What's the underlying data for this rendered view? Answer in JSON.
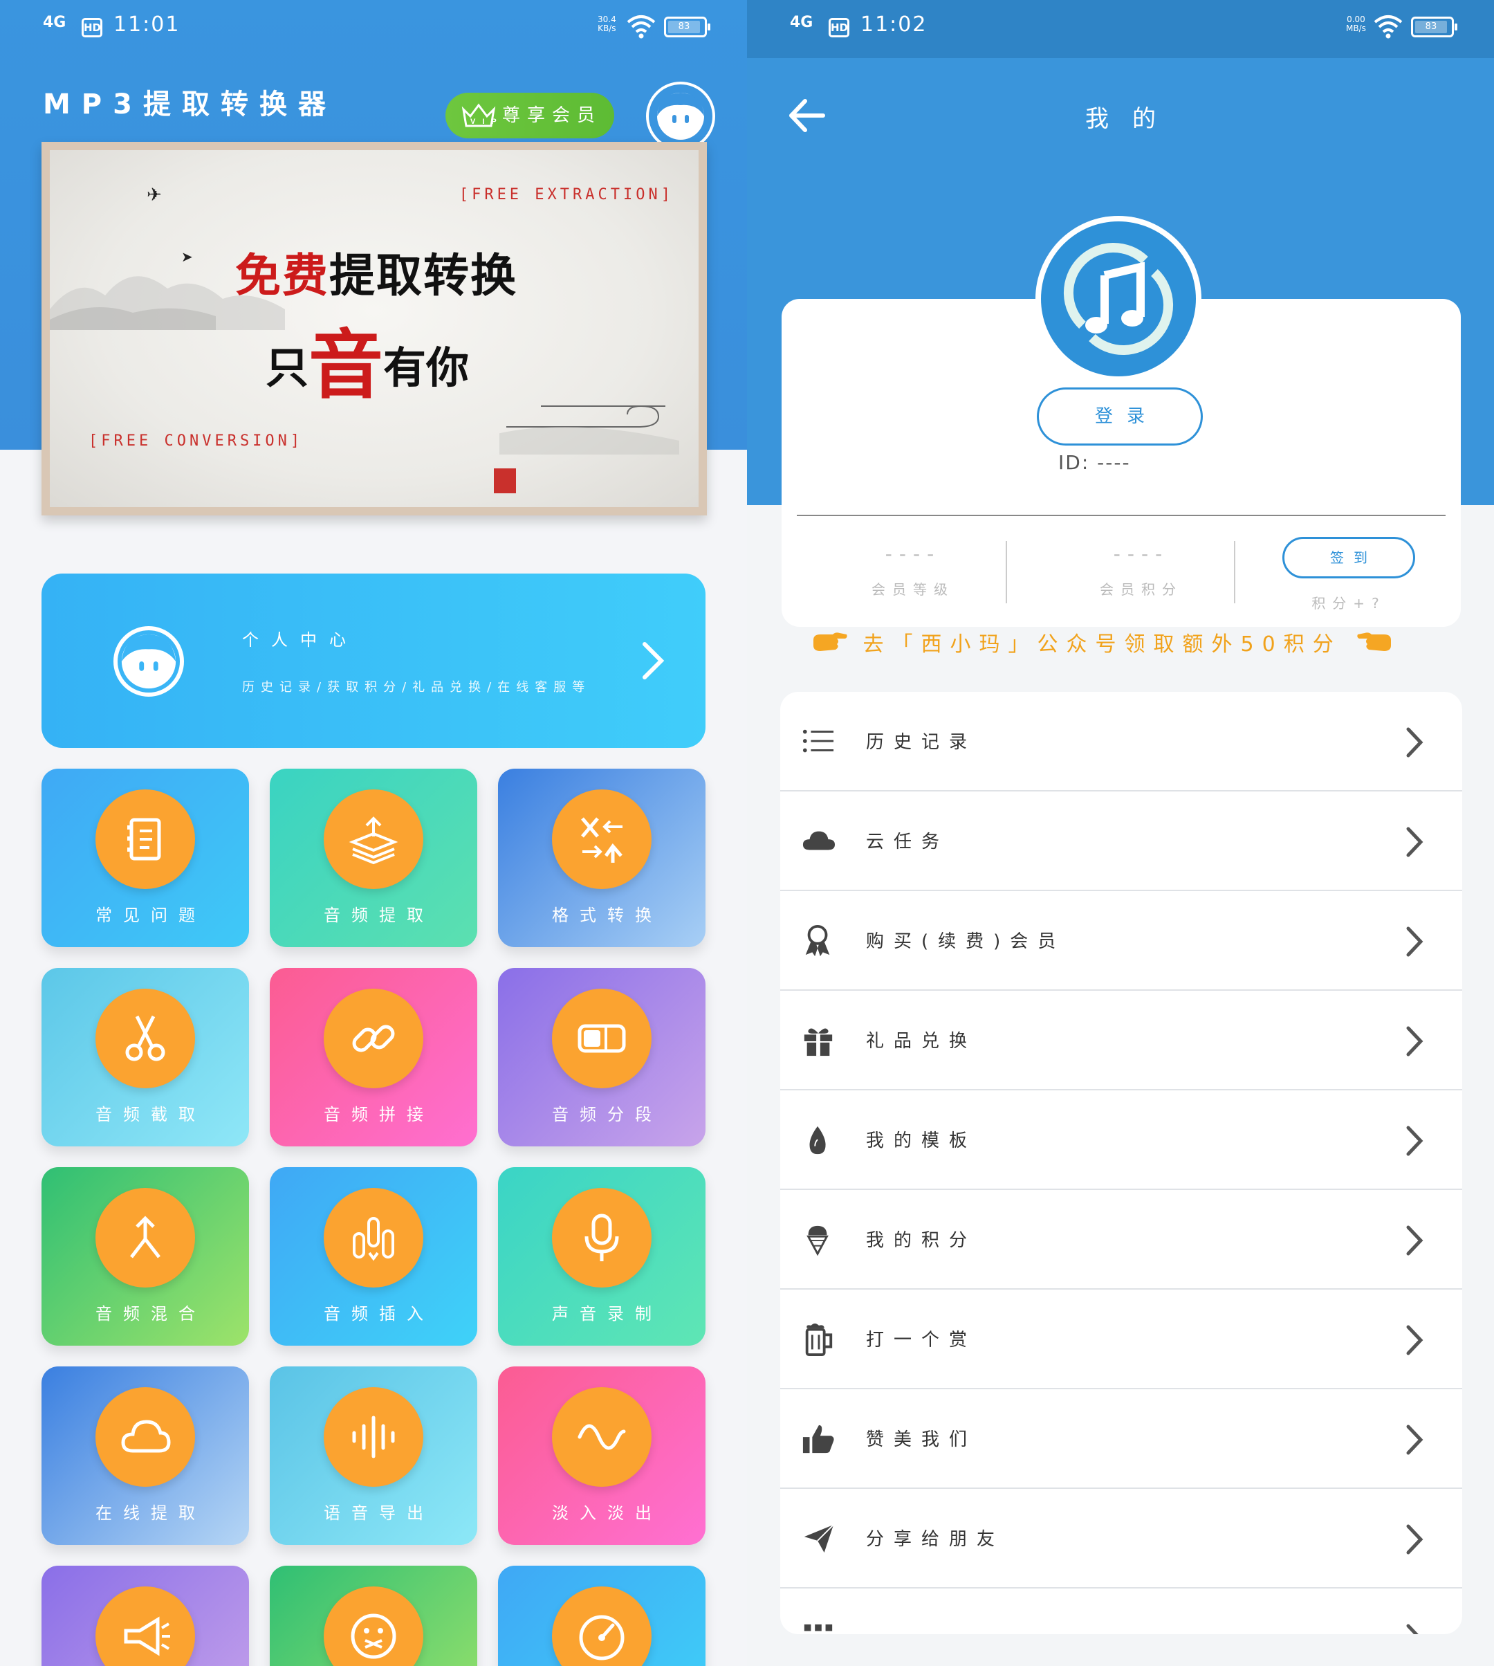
{
  "left": {
    "status": {
      "signal": "4G",
      "hd": "HD",
      "time": "11:01",
      "speed": "30.4\nKB/s",
      "battery": "83"
    },
    "app_title": "MP3提取转换器",
    "vip_label": "尊享会员",
    "banner": {
      "tag_top": "[FREE EXTRACTION]",
      "line1_red": "免费",
      "line1_rest": "提取转换",
      "line2_a": "只",
      "line2_big": "音",
      "line2_b": "有你",
      "tag_bottom": "[FREE CONVERSION]"
    },
    "personal": {
      "title": "个人中心",
      "subtitle": "历史记录/获取积分/礼品兑换/在线客服等"
    },
    "tiles": [
      {
        "label": "常见问题",
        "icon": "contacts-book-icon",
        "g1": "#3fa9f5",
        "g2": "#3fc9f7"
      },
      {
        "label": "音频提取",
        "icon": "layers-upload-icon",
        "g1": "#3ad3c2",
        "g2": "#5ce0b0"
      },
      {
        "label": "格式转换",
        "icon": "x-to-y-icon",
        "g1": "#3a7fe0",
        "g2": "#a8cff5"
      },
      {
        "label": "音频截取",
        "icon": "scissors-icon",
        "g1": "#5cc7e8",
        "g2": "#8fe7f7"
      },
      {
        "label": "音频拼接",
        "icon": "link-icon",
        "g1": "#fb5c92",
        "g2": "#ff6fd0"
      },
      {
        "label": "音频分段",
        "icon": "segment-toggle-icon",
        "g1": "#8a6fe8",
        "g2": "#c8a4ea"
      },
      {
        "label": "音频混合",
        "icon": "merge-arrow-icon",
        "g1": "#2fbf74",
        "g2": "#9ee36a"
      },
      {
        "label": "音频插入",
        "icon": "bars-insert-icon",
        "g1": "#3fa8f5",
        "g2": "#3fd2f8"
      },
      {
        "label": "声音录制",
        "icon": "microphone-icon",
        "g1": "#3ad4c6",
        "g2": "#5fe6b4"
      },
      {
        "label": "在线提取",
        "icon": "cloud-icon",
        "g1": "#3a7fe0",
        "g2": "#b6d6f5"
      },
      {
        "label": "语音导出",
        "icon": "waveform-icon",
        "g1": "#5ac3e6",
        "g2": "#8de8f7"
      },
      {
        "label": "淡入淡出",
        "icon": "sine-wave-icon",
        "g1": "#fb5c92",
        "g2": "#ff70d2"
      },
      {
        "label": "",
        "icon": "megaphone-icon",
        "g1": "#8a6fe8",
        "g2": "#c8a4ea"
      },
      {
        "label": "",
        "icon": "sad-face-icon",
        "g1": "#2fbf74",
        "g2": "#9ee36a"
      },
      {
        "label": "",
        "icon": "speed-gauge-icon",
        "g1": "#3fa8f5",
        "g2": "#3fd2f8"
      }
    ]
  },
  "right": {
    "status": {
      "signal": "4G",
      "hd": "HD",
      "time": "11:02",
      "speed": "0.00\nMB/s",
      "battery": "83"
    },
    "nav_title": "我的",
    "login_label": "登录",
    "user_id": "ID: ----",
    "stats": [
      {
        "value": "----",
        "label": "会员等级"
      },
      {
        "value": "----",
        "label": "会员积分"
      }
    ],
    "sign_label": "签到",
    "sign_hint": "积分+?",
    "promo": "去「西小玛」公众号领取额外50积分",
    "menu": [
      {
        "label": "历史记录",
        "icon": "list-icon"
      },
      {
        "label": "云任务",
        "icon": "cloud-icon"
      },
      {
        "label": "购买(续费)会员",
        "icon": "award-ribbon-icon"
      },
      {
        "label": "礼品兑换",
        "icon": "gift-icon"
      },
      {
        "label": "我的模板",
        "icon": "flame-icon"
      },
      {
        "label": "我的积分",
        "icon": "ice-cream-icon"
      },
      {
        "label": "打一个赏",
        "icon": "beer-mug-icon"
      },
      {
        "label": "赞美我们",
        "icon": "thumbs-up-icon"
      },
      {
        "label": "分享给朋友",
        "icon": "paper-plane-icon"
      },
      {
        "label": "",
        "icon": "grid-icon"
      }
    ]
  }
}
